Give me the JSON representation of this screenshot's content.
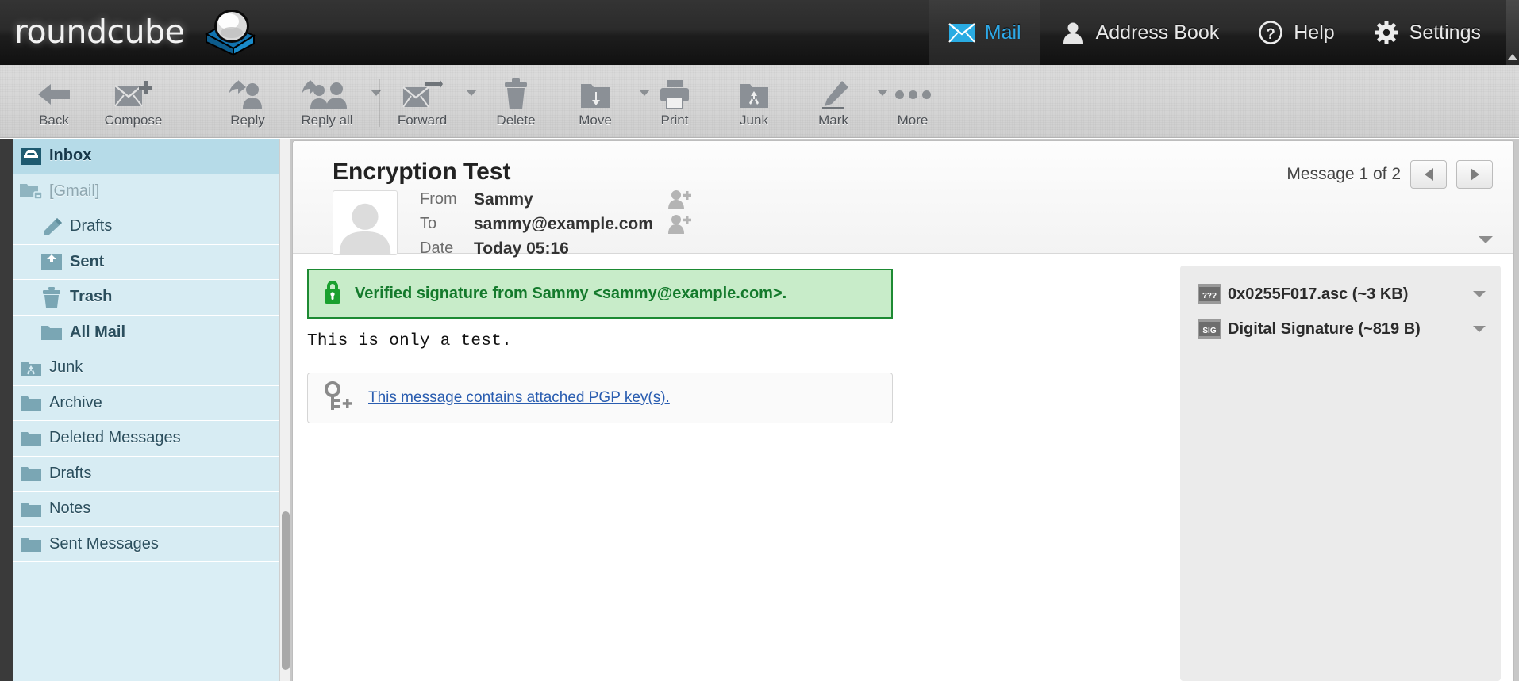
{
  "app": {
    "brand": "roundcube",
    "brand_icon": "roundcube-logo-icon"
  },
  "topnav": {
    "tabs": [
      {
        "label": "Mail",
        "icon": "envelope-icon",
        "active": true
      },
      {
        "label": "Address Book",
        "icon": "person-icon",
        "active": false
      },
      {
        "label": "Help",
        "icon": "question-mark-circle-icon",
        "active": false
      },
      {
        "label": "Settings",
        "icon": "gear-icon",
        "active": false
      }
    ],
    "scroll_up_icon": "scroll-up-arrow-icon"
  },
  "toolbar": {
    "buttons": [
      {
        "label": "Back",
        "icon": "back-arrow-icon",
        "has_caret": false
      },
      {
        "label": "Compose",
        "icon": "compose-mail-icon",
        "has_caret": false
      },
      {
        "label": "Reply",
        "icon": "reply-icon",
        "has_caret": false
      },
      {
        "label": "Reply all",
        "icon": "reply-all-icon",
        "has_caret": true
      },
      {
        "label": "Forward",
        "icon": "forward-icon",
        "has_caret": true
      },
      {
        "label": "Delete",
        "icon": "trash-icon",
        "has_caret": false
      },
      {
        "label": "Move",
        "icon": "move-folder-icon",
        "has_caret": true
      },
      {
        "label": "Print",
        "icon": "printer-icon",
        "has_caret": false
      },
      {
        "label": "Junk",
        "icon": "junk-folder-icon",
        "has_caret": false
      },
      {
        "label": "Mark",
        "icon": "marker-pen-icon",
        "has_caret": true
      },
      {
        "label": "More",
        "icon": "ellipsis-icon",
        "has_caret": false
      }
    ]
  },
  "sidebar": {
    "folders": [
      {
        "label": "Inbox",
        "icon": "inbox-icon",
        "selected": true,
        "indent": 0,
        "bold": true,
        "muted": false
      },
      {
        "label": "[Gmail]",
        "icon": "folder-collapsed-icon",
        "selected": false,
        "indent": 0,
        "bold": false,
        "muted": true
      },
      {
        "label": "Drafts",
        "icon": "pencil-icon",
        "selected": false,
        "indent": 1,
        "bold": false,
        "muted": false
      },
      {
        "label": "Sent",
        "icon": "sent-icon",
        "selected": false,
        "indent": 1,
        "bold": true,
        "muted": false
      },
      {
        "label": "Trash",
        "icon": "trash-icon",
        "selected": false,
        "indent": 1,
        "bold": true,
        "muted": false
      },
      {
        "label": "All Mail",
        "icon": "folder-icon",
        "selected": false,
        "indent": 1,
        "bold": true,
        "muted": false
      },
      {
        "label": "Junk",
        "icon": "junk-folder-icon",
        "selected": false,
        "indent": 0,
        "bold": false,
        "muted": false
      },
      {
        "label": "Archive",
        "icon": "folder-icon",
        "selected": false,
        "indent": 0,
        "bold": false,
        "muted": false
      },
      {
        "label": "Deleted Messages",
        "icon": "folder-icon",
        "selected": false,
        "indent": 0,
        "bold": false,
        "muted": false
      },
      {
        "label": "Drafts",
        "icon": "folder-icon",
        "selected": false,
        "indent": 0,
        "bold": false,
        "muted": false
      },
      {
        "label": "Notes",
        "icon": "folder-icon",
        "selected": false,
        "indent": 0,
        "bold": false,
        "muted": false
      },
      {
        "label": "Sent Messages",
        "icon": "folder-icon",
        "selected": false,
        "indent": 0,
        "bold": false,
        "muted": false
      }
    ]
  },
  "message": {
    "subject": "Encryption Test",
    "counter": "Message 1 of 2",
    "prev_icon": "previous-message-arrow-icon",
    "next_icon": "next-message-arrow-icon",
    "expand_icon": "chevron-down-icon",
    "avatar_icon": "contact-placeholder-avatar-icon",
    "fields": [
      {
        "label": "From",
        "value": "Sammy",
        "add_contact_icon": "add-contact-icon"
      },
      {
        "label": "To",
        "value": "sammy@example.com",
        "add_contact_icon": "add-contact-icon"
      },
      {
        "label": "Date",
        "value": "Today 05:16",
        "add_contact_icon": null
      }
    ],
    "signature": {
      "icon": "green-padlock-icon",
      "text": "Verified signature from Sammy <sammy@example.com>.",
      "bg_color": "#c8ecc9",
      "border_color": "#1d8a33",
      "text_color": "#147a2c"
    },
    "body_text": "This is only a test.",
    "pgp_notice": {
      "icon": "pgp-key-add-icon",
      "link_text": "This message contains attached PGP key(s).",
      "link_color": "#2a5db0"
    },
    "attachments": [
      {
        "name": "0x0255F017.asc (~3 KB)",
        "icon": "unknown-file-icon",
        "icon_label": "???",
        "caret_icon": "chevron-down-icon"
      },
      {
        "name": "Digital Signature (~819 B)",
        "icon": "signature-file-icon",
        "icon_label": "SIG",
        "caret_icon": "chevron-down-icon"
      }
    ]
  }
}
